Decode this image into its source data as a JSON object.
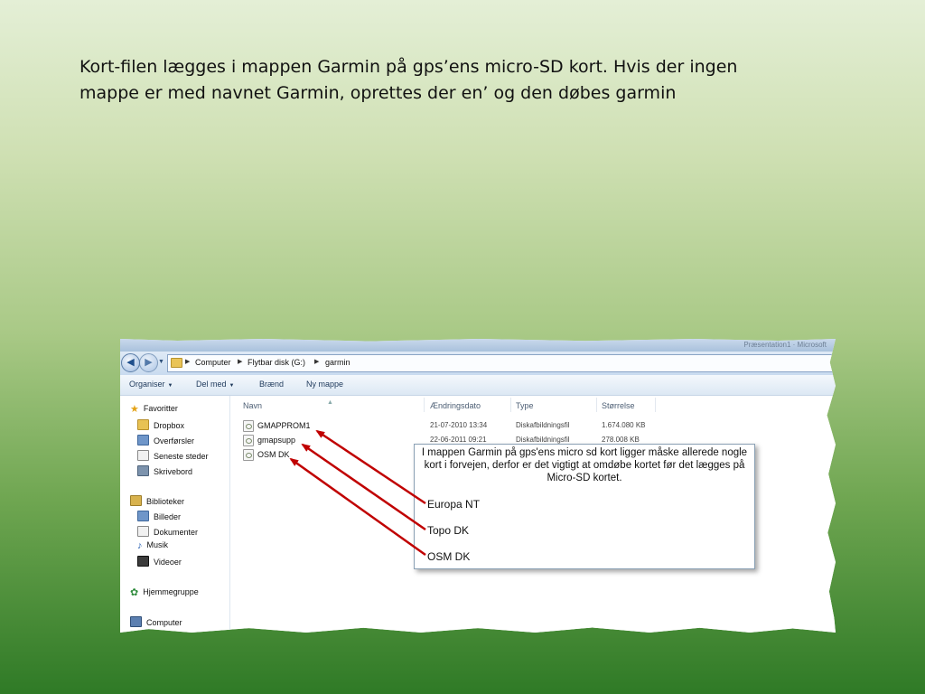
{
  "slide": {
    "title_line1": "Kort-filen lægges i mappen Garmin på gps’ens micro-SD kort. Hvis der ingen",
    "title_line2": "mappe er med navnet Garmin, oprettes der en’ og den døbes garmin"
  },
  "explorer": {
    "titlebar_text": "Præsentation1 · Microsoft",
    "breadcrumb": [
      "Computer",
      "Flytbar disk (G:)",
      "garmin"
    ],
    "toolbar": {
      "organize": "Organiser",
      "share": "Del med",
      "burn": "Brænd",
      "new_folder": "Ny mappe"
    },
    "nav": {
      "favorites_header": "Favoritter",
      "favorites": [
        "Dropbox",
        "Overførsler",
        "Seneste steder",
        "Skrivebord"
      ],
      "libraries_header": "Biblioteker",
      "libraries": [
        "Billeder",
        "Dokumenter",
        "Musik",
        "Videoer"
      ],
      "homegroup": "Hjemmegruppe",
      "computer": "Computer"
    },
    "columns": {
      "name": "Navn",
      "modified": "Ændringsdato",
      "type": "Type",
      "size": "Størrelse"
    },
    "files": [
      {
        "name": "GMAPPROM1",
        "modified": "21-07-2010 13:34",
        "type": "Diskafbildningsfil",
        "size": "1.674.080 KB"
      },
      {
        "name": "gmapsupp",
        "modified": "22-06-2011 09:21",
        "type": "Diskafbildningsfil",
        "size": "278.008 KB"
      },
      {
        "name": "OSM DK",
        "modified": "",
        "type": "",
        "size": ""
      }
    ]
  },
  "callout": {
    "text": "I mappen Garmin på gps'ens micro sd kort ligger måske allerede nogle kort i forvejen, derfor er det vigtigt at omdøbe kortet før det lægges på Micro-SD kortet.",
    "labels": [
      "Europa NT",
      "Topo DK",
      "OSM DK"
    ]
  },
  "colors": {
    "arrow": "#c00000",
    "background_top": "#e4efd6",
    "background_bottom": "#2f7a26"
  }
}
